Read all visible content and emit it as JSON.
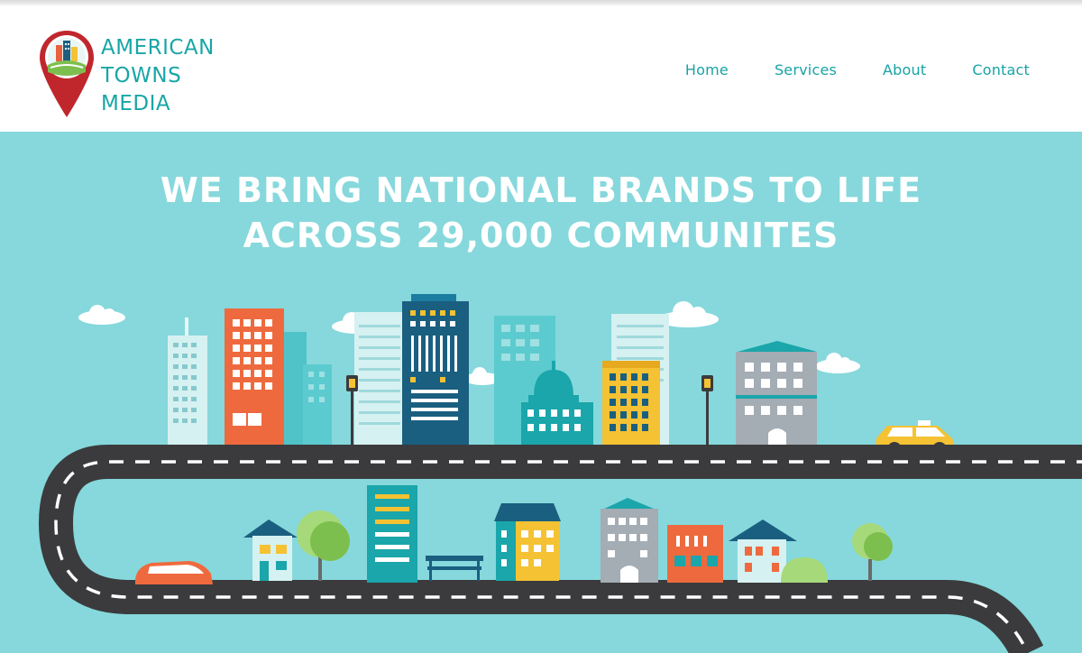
{
  "brand": {
    "name_lines": [
      "AMERICAN",
      "TOWNS",
      "MEDIA"
    ],
    "logo_icon": "map-pin-city-icon"
  },
  "nav": {
    "items": [
      {
        "label": "Home"
      },
      {
        "label": "Services"
      },
      {
        "label": "About"
      },
      {
        "label": "Contact"
      }
    ]
  },
  "hero": {
    "headline_lines": [
      "WE BRING NATIONAL BRANDS TO LIFE",
      "ACROSS 29,000 COMMUNITES"
    ],
    "illustration": "city-road-illustration"
  },
  "colors": {
    "brand_teal": "#19a6a6",
    "hero_bg": "#86d8dc",
    "road": "#3b3b3d",
    "pin_red": "#c0272d"
  }
}
